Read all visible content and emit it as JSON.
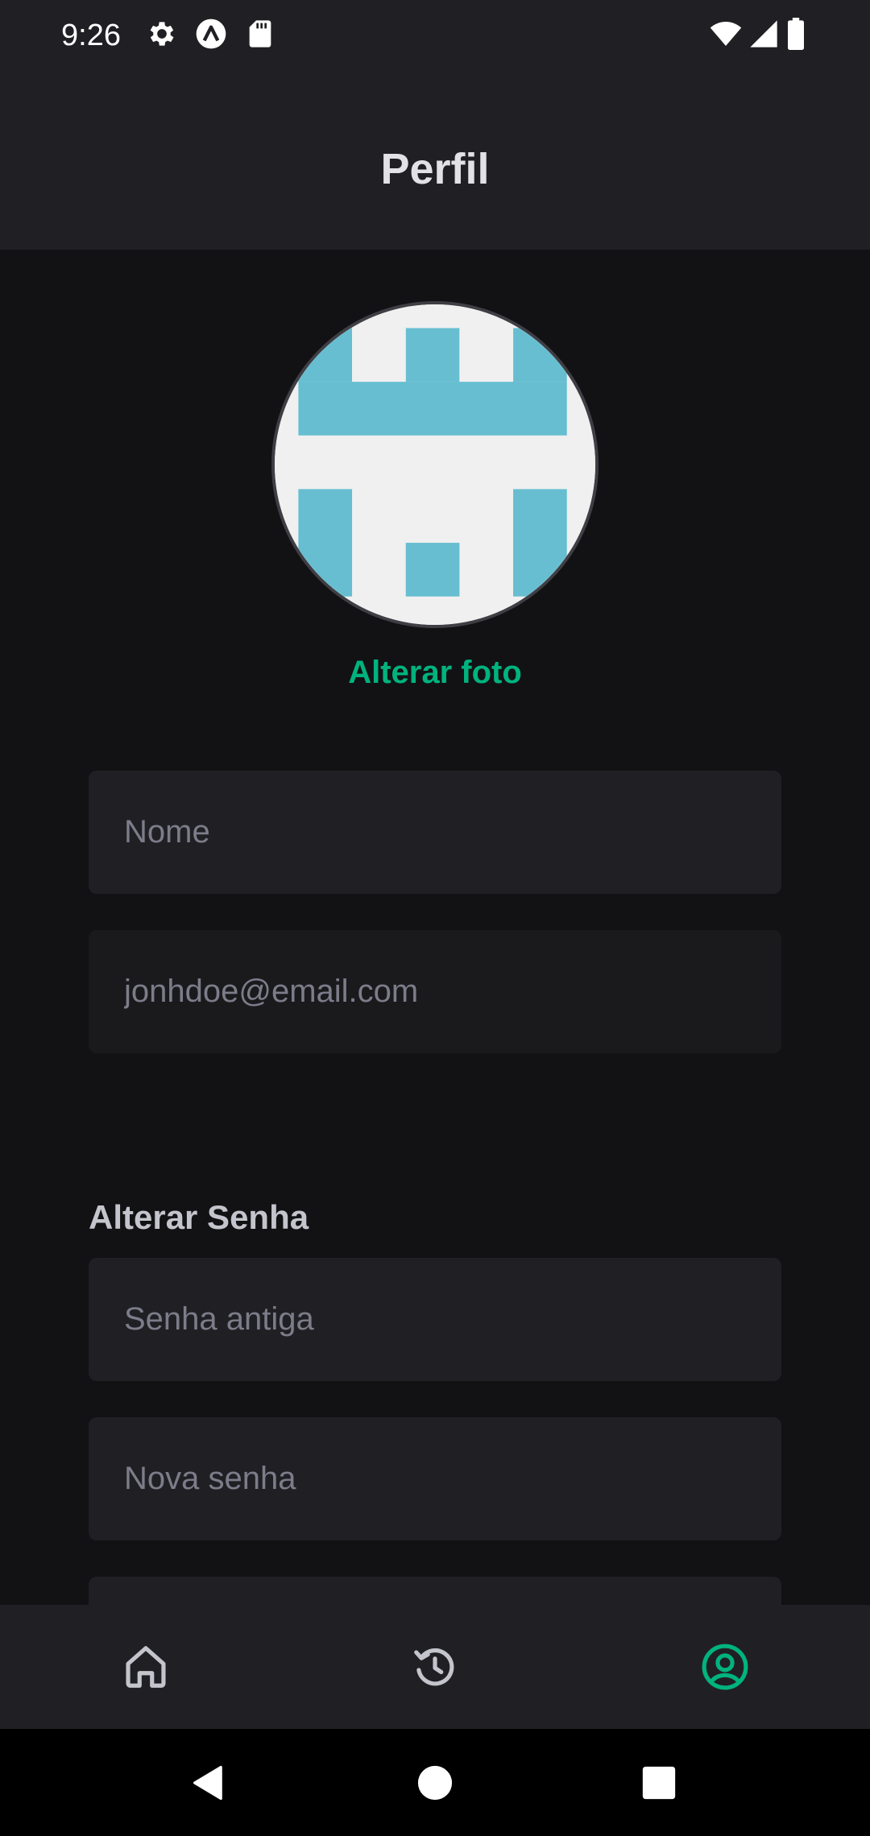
{
  "status_bar": {
    "time": "9:26",
    "icons": [
      "settings-icon",
      "app-a-icon",
      "sd-card-icon",
      "wifi-icon",
      "signal-icon",
      "battery-icon"
    ]
  },
  "header": {
    "title": "Perfil"
  },
  "profile": {
    "change_photo_label": "Alterar foto"
  },
  "form": {
    "name_placeholder": "Nome",
    "email_value": "jonhdoe@email.com"
  },
  "password_section": {
    "title": "Alterar Senha",
    "old_password_placeholder": "Senha antiga",
    "new_password_placeholder": "Nova senha"
  },
  "tab_bar": {
    "items": [
      {
        "icon": "home-icon",
        "active": false
      },
      {
        "icon": "history-icon",
        "active": false
      },
      {
        "icon": "user-circle-icon",
        "active": true
      }
    ]
  },
  "colors": {
    "accent": "#00b37e",
    "background": "#121214",
    "surface": "#202024",
    "text_primary": "#e1e1e6",
    "placeholder": "#7c7c8a",
    "avatar_pattern": "#67bed1",
    "avatar_background": "#f0f0f0"
  }
}
